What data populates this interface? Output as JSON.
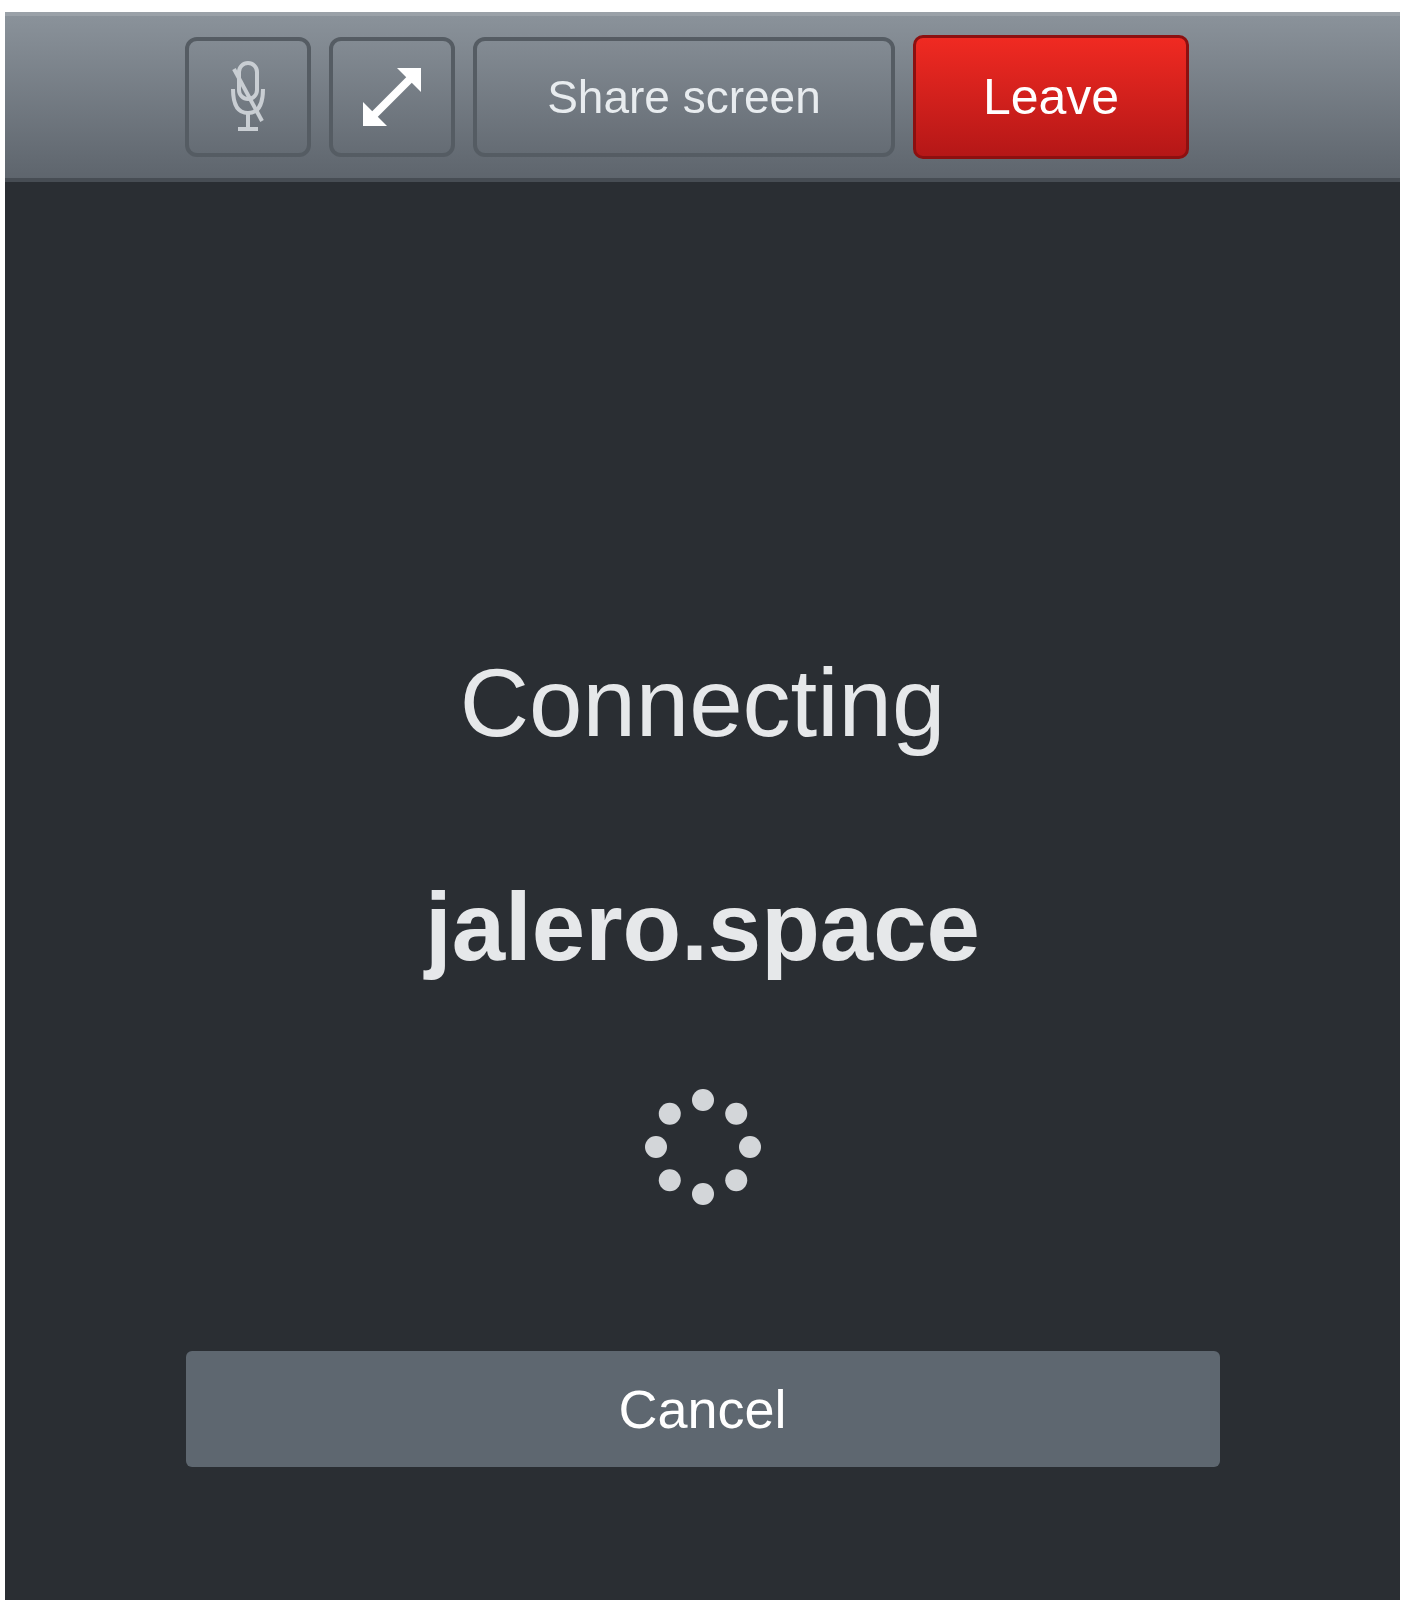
{
  "toolbar": {
    "mic_muted": true,
    "share_label": "Share screen",
    "leave_label": "Leave"
  },
  "status": {
    "title": "Connecting",
    "host": "jalero.space"
  },
  "cancel_label": "Cancel"
}
